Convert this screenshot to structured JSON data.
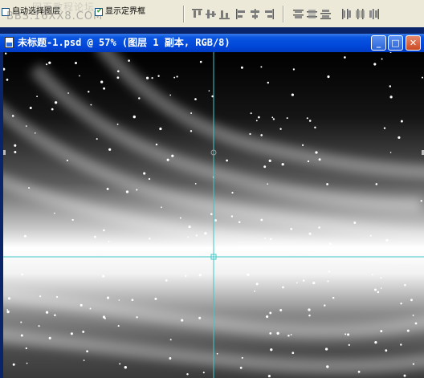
{
  "options_bar": {
    "auto_select_label": "自动选择图层",
    "auto_select_checked": false,
    "show_bounds_label": "显示定界框",
    "show_bounds_checked": true,
    "watermark_text": "BBS.16XX8.COM",
    "watermark_cn": "网页教程论坛",
    "align_icons": [
      "align-top-icon",
      "align-vcenter-icon",
      "align-bottom-icon",
      "align-left-icon",
      "align-hcenter-icon",
      "align-right-icon"
    ],
    "distribute_icons": [
      "distribute-top-icon",
      "distribute-vcenter-icon",
      "distribute-bottom-icon",
      "distribute-left-icon",
      "distribute-hcenter-icon",
      "distribute-right-icon"
    ]
  },
  "document": {
    "title": "未标题-1.psd @ 57% (图层 1 副本, RGB/8)",
    "zoom": "57%",
    "color_mode": "RGB/8",
    "window_buttons": {
      "minimize": "_",
      "maximize": "□",
      "close": "✕"
    }
  },
  "colors": {
    "title_bar": "#0046d8",
    "guide": "#3fc8c8",
    "canvas_dark": "#000000",
    "canvas_light": "#ffffff"
  }
}
